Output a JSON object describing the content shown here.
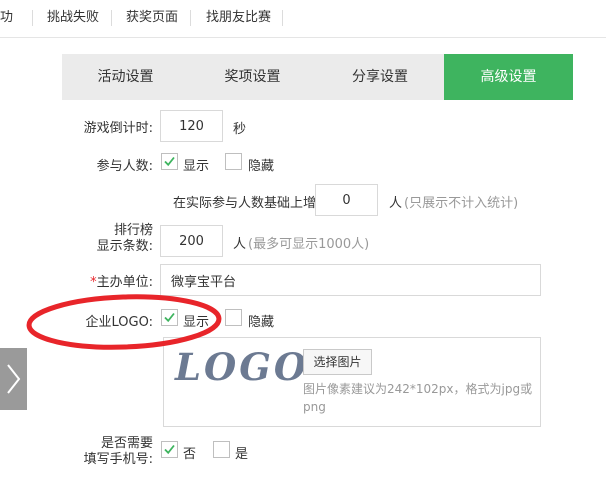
{
  "top_tabs": [
    "成功",
    "挑战失败",
    "获奖页面",
    "找朋友比赛"
  ],
  "settings_tabs": [
    {
      "label": "活动设置",
      "active": false
    },
    {
      "label": "奖项设置",
      "active": false
    },
    {
      "label": "分享设置",
      "active": false
    },
    {
      "label": "高级设置",
      "active": true
    }
  ],
  "countdown": {
    "label": "游戏倒计时:",
    "value": "120",
    "unit": "秒"
  },
  "participants": {
    "label": "参与人数:",
    "show_label": "显示",
    "show_checked": true,
    "hide_label": "隐藏",
    "hide_checked": false,
    "increase_label": "在实际参与人数基础上增加",
    "increase_value": "0",
    "increase_unit": "人",
    "increase_hint": "(只展示不计入统计)"
  },
  "ranking": {
    "label_line1": "排行榜",
    "label_line2": "显示条数:",
    "value": "200",
    "unit": "人",
    "hint": "(最多可显示1000人)"
  },
  "organizer": {
    "required_mark": "*",
    "label": "主办单位:",
    "value": "微享宝平台"
  },
  "company_logo": {
    "label": "企业LOGO:",
    "show_label": "显示",
    "show_checked": true,
    "hide_label": "隐藏",
    "hide_checked": false,
    "logo_text": "LOGO",
    "select_button": "选择图片",
    "hint": "图片像素建议为242*102px，格式为jpg或png"
  },
  "phone_required": {
    "label_line1": "是否需要",
    "label_line2": "填写手机号:",
    "no_label": "否",
    "no_checked": true,
    "yes_label": "是",
    "yes_checked": false
  },
  "colors": {
    "accent": "#3eb45f",
    "annotation": "#e8252a"
  }
}
